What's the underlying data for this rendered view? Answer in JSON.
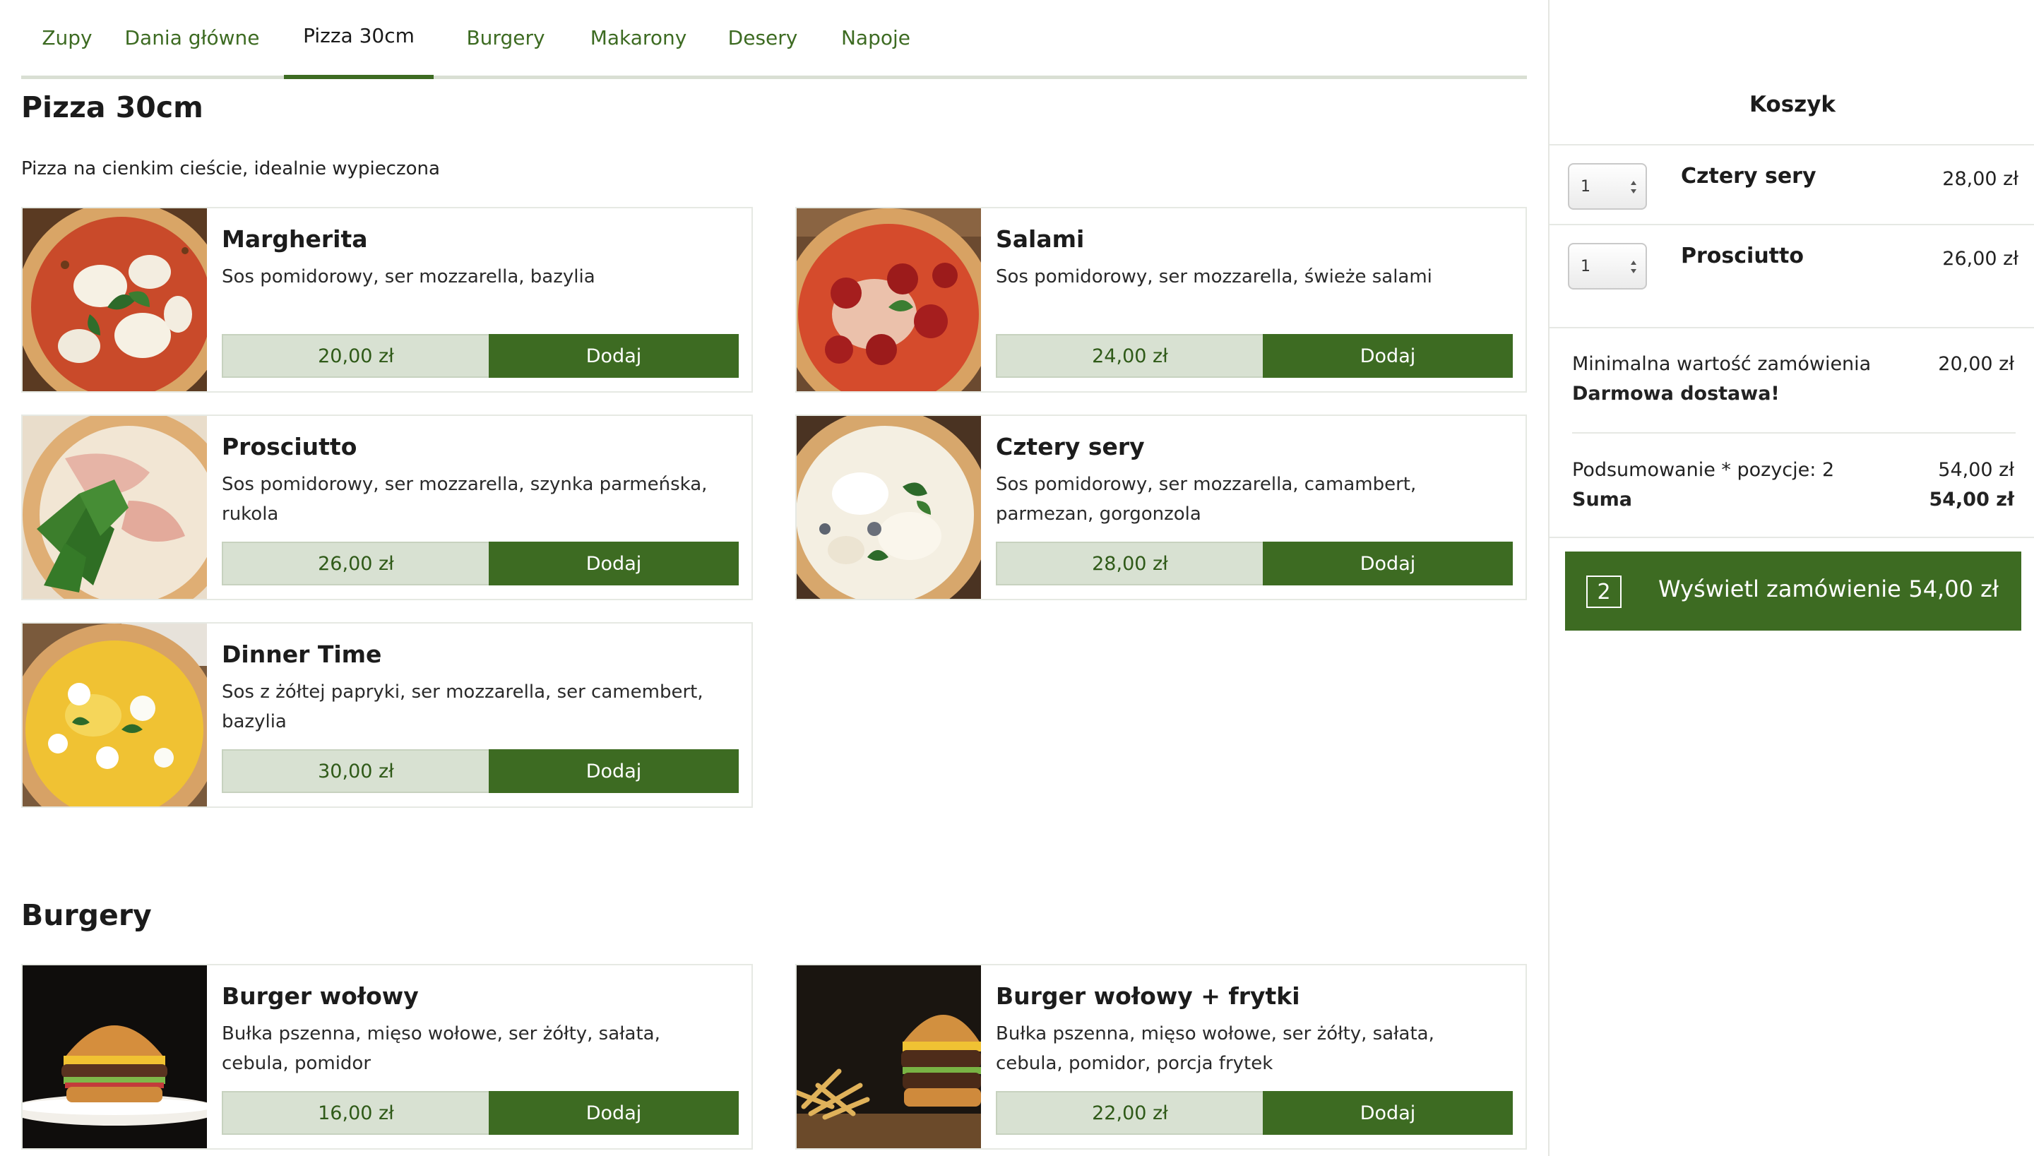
{
  "tabs": [
    {
      "label": "Zupy"
    },
    {
      "label": "Dania główne"
    },
    {
      "label": "Pizza 30cm"
    },
    {
      "label": "Burgery"
    },
    {
      "label": "Makarony"
    },
    {
      "label": "Desery"
    },
    {
      "label": "Napoje"
    }
  ],
  "active_tab": "Pizza 30cm",
  "pizza": {
    "title": "Pizza 30cm",
    "description": "Pizza na cienkim cieście, idealnie wypieczona",
    "items": [
      {
        "name": "Margherita",
        "description": "Sos pomidorowy, ser mozzarella, bazylia",
        "price": "20,00 zł",
        "add_label": "Dodaj"
      },
      {
        "name": "Salami",
        "description": "Sos pomidorowy, ser mozzarella, świeże salami",
        "price": "24,00 zł",
        "add_label": "Dodaj"
      },
      {
        "name": "Prosciutto",
        "description": "Sos pomidorowy, ser mozzarella, szynka parmeńska, rukola",
        "price": "26,00 zł",
        "add_label": "Dodaj"
      },
      {
        "name": "Cztery sery",
        "description": "Sos pomidorowy, ser mozzarella, camambert, parmezan, gorgonzola",
        "price": "28,00 zł",
        "add_label": "Dodaj"
      },
      {
        "name": "Dinner Time",
        "description": "Sos z żółtej papryki, ser mozzarella, ser camembert, bazylia",
        "price": "30,00 zł",
        "add_label": "Dodaj"
      }
    ]
  },
  "burgers": {
    "title": "Burgery",
    "items": [
      {
        "name": "Burger wołowy",
        "description": "Bułka pszenna, mięso wołowe, ser żółty, sałata, cebula, pomidor",
        "price": "16,00 zł",
        "add_label": "Dodaj"
      },
      {
        "name": "Burger wołowy + frytki",
        "description": "Bułka pszenna, mięso wołowe, ser żółty, sałata, cebula, pomidor, porcja frytek",
        "price": "22,00 zł",
        "add_label": "Dodaj"
      }
    ]
  },
  "cart": {
    "title": "Koszyk",
    "items": [
      {
        "qty": "1",
        "name": "Cztery sery",
        "price": "28,00 zł"
      },
      {
        "qty": "1",
        "name": "Prosciutto",
        "price": "26,00 zł"
      }
    ],
    "min_order_label": "Minimalna wartość zamówienia",
    "min_order_value": "20,00 zł",
    "free_delivery": "Darmowa dostawa!",
    "summary_label": "Podsumowanie * pozycje: 2",
    "summary_value": "54,00 zł",
    "total_label": "Suma",
    "total_value": "54,00 zł",
    "order_button": {
      "count": "2",
      "label": "Wyświetl zamówienie",
      "total": "54,00 zł"
    }
  },
  "colors": {
    "accent": "#3d6b22",
    "price_bg": "#d8e1d2",
    "tab_underline": "#d9dfd3"
  }
}
